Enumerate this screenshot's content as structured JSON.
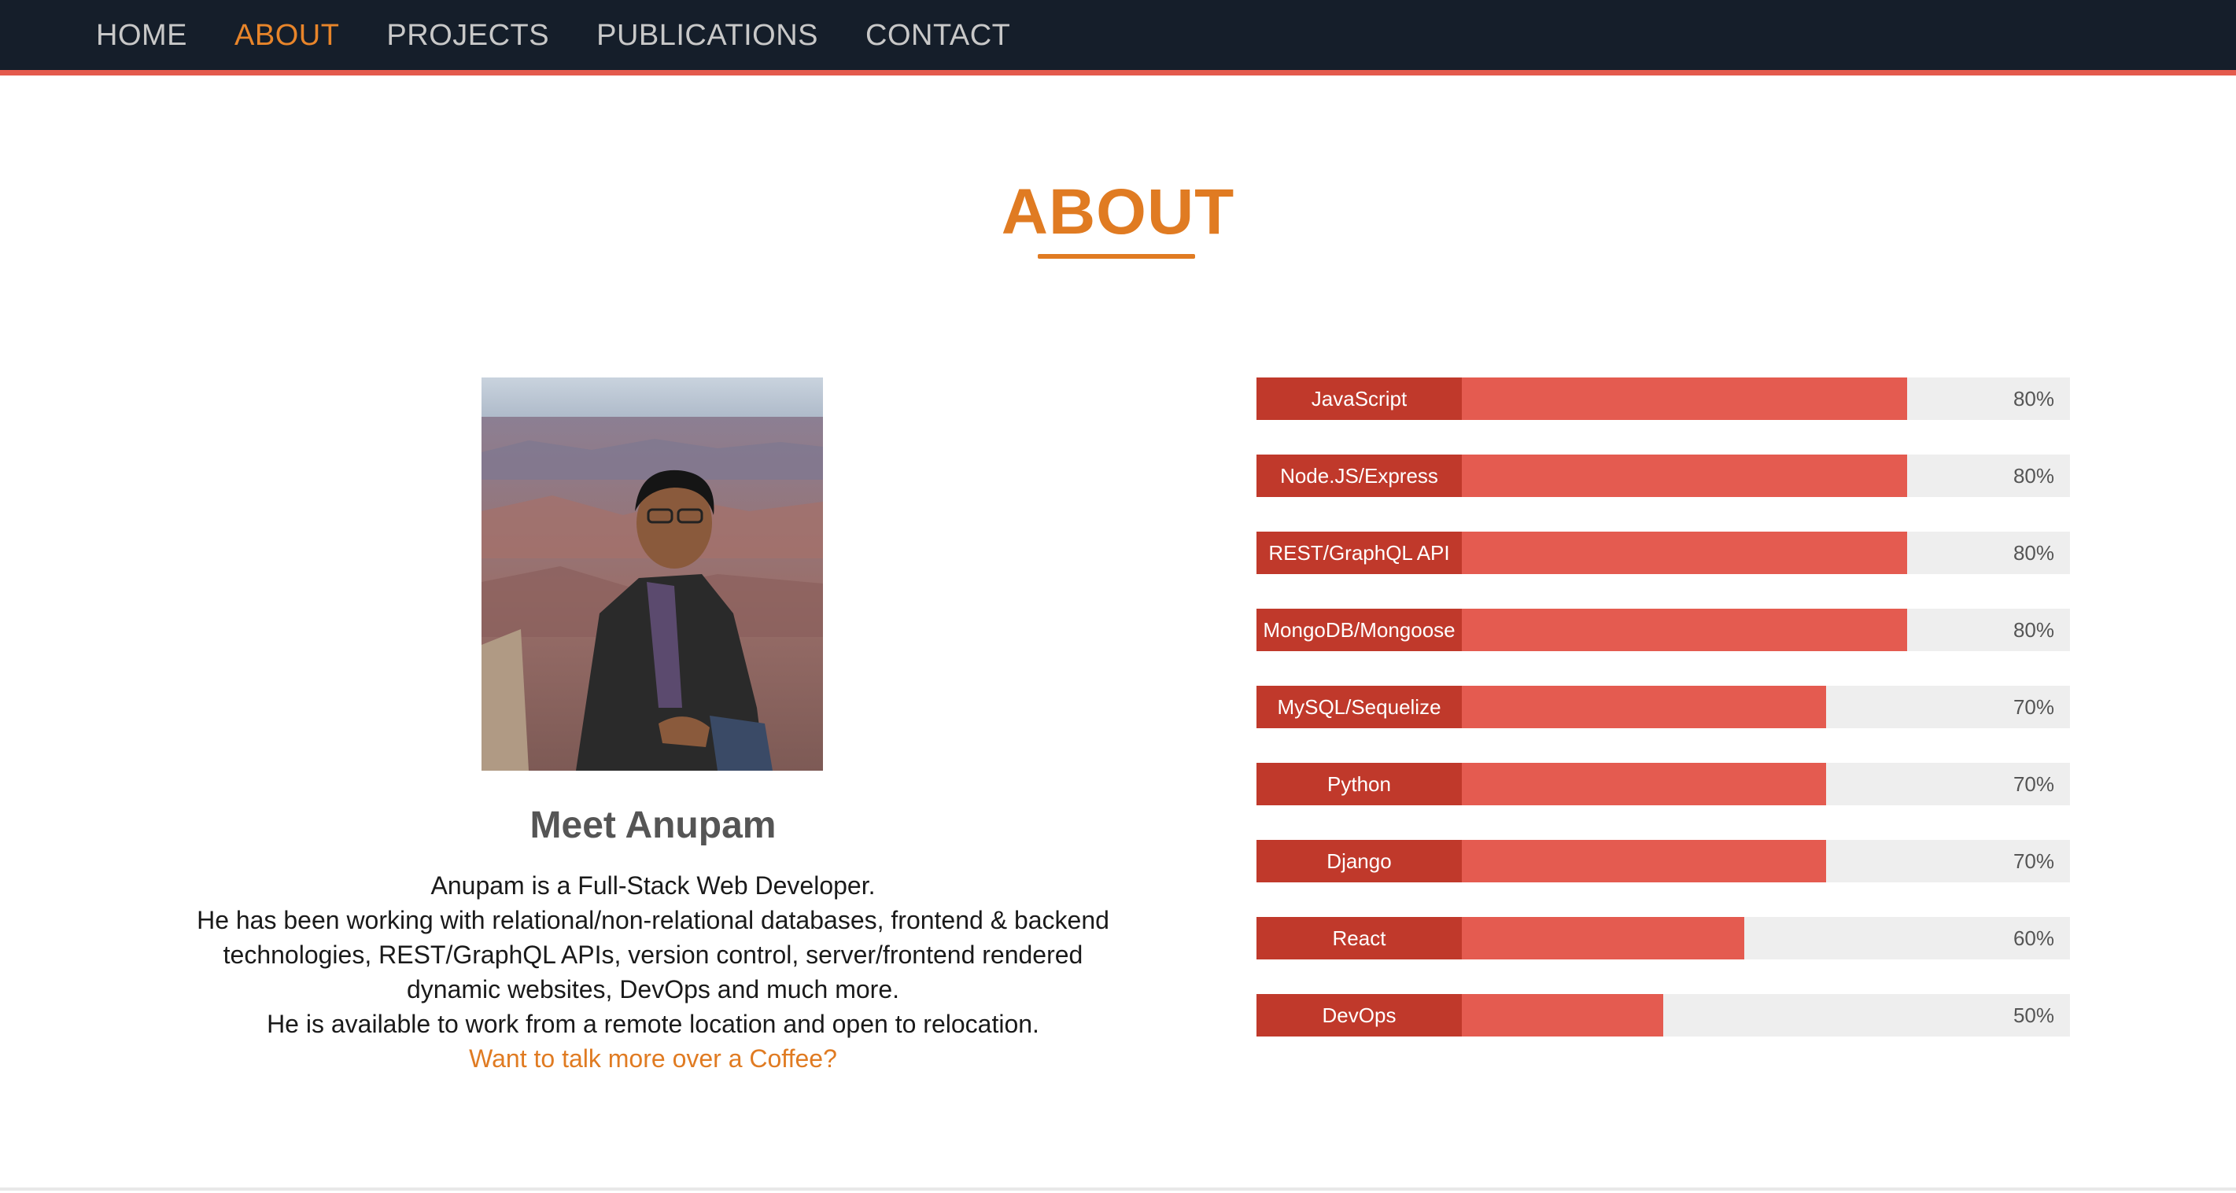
{
  "nav": {
    "items": [
      {
        "label": "HOME",
        "active": false
      },
      {
        "label": "ABOUT",
        "active": true
      },
      {
        "label": "PROJECTS",
        "active": false
      },
      {
        "label": "PUBLICATIONS",
        "active": false
      },
      {
        "label": "CONTACT",
        "active": false
      }
    ]
  },
  "about": {
    "title": "ABOUT",
    "heading": "Meet Anupam",
    "bio": [
      "Anupam is a Full-Stack Web Developer.",
      "He has been working with relational/non-relational databases, frontend & backend technologies, REST/GraphQL APIs, version control, server/frontend rendered dynamic websites, DevOps and much more.",
      "He is available to work from a remote location and open to relocation."
    ],
    "coffee_link": "Want to talk more over a Coffee?"
  },
  "skills": [
    {
      "name": "JavaScript",
      "percent_label": "80%",
      "level": 80
    },
    {
      "name": "Node.JS/Express",
      "percent_label": "80%",
      "level": 80
    },
    {
      "name": "REST/GraphQL API",
      "percent_label": "80%",
      "level": 80
    },
    {
      "name": "MongoDB/Mongoose",
      "percent_label": "80%",
      "level": 80
    },
    {
      "name": "MySQL/Sequelize",
      "percent_label": "70%",
      "level": 70
    },
    {
      "name": "Python",
      "percent_label": "70%",
      "level": 70
    },
    {
      "name": "Django",
      "percent_label": "70%",
      "level": 70
    },
    {
      "name": "React",
      "percent_label": "60%",
      "level": 60
    },
    {
      "name": "DevOps",
      "percent_label": "50%",
      "level": 50
    }
  ],
  "colors": {
    "nav_bg": "#151e2a",
    "accent": "#e07b22",
    "bar_label": "#c0392b",
    "bar_fill": "#e45b50",
    "bar_track": "#eeeeee"
  }
}
